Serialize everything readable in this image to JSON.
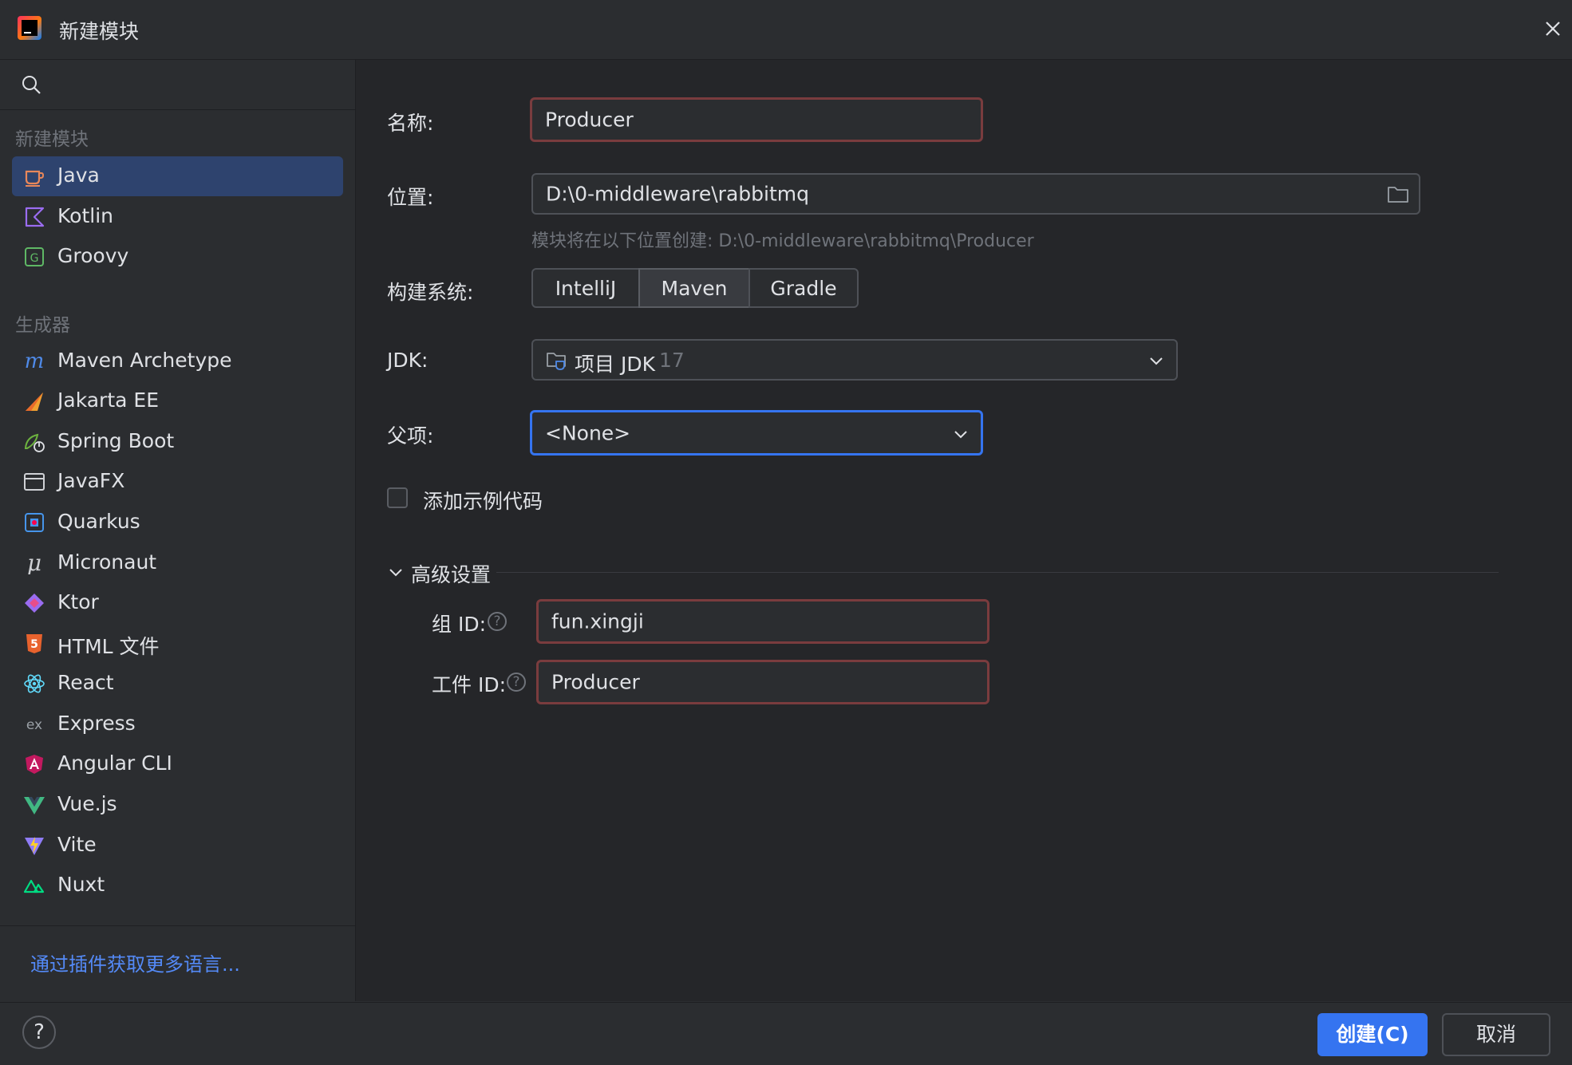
{
  "window": {
    "title": "新建模块"
  },
  "sidebar": {
    "group_new_module": "新建模块",
    "languages": [
      {
        "label": "Java",
        "icon": "java-cup-icon",
        "selected": true
      },
      {
        "label": "Kotlin",
        "icon": "kotlin-icon"
      },
      {
        "label": "Groovy",
        "icon": "groovy-icon"
      }
    ],
    "group_generators": "生成器",
    "generators": [
      {
        "label": "Maven Archetype",
        "icon": "maven-icon"
      },
      {
        "label": "Jakarta EE",
        "icon": "jakarta-ee-icon"
      },
      {
        "label": "Spring Boot",
        "icon": "spring-boot-icon"
      },
      {
        "label": "JavaFX",
        "icon": "javafx-window-icon"
      },
      {
        "label": "Quarkus",
        "icon": "quarkus-icon"
      },
      {
        "label": "Micronaut",
        "icon": "micronaut-icon"
      },
      {
        "label": "Ktor",
        "icon": "ktor-icon"
      },
      {
        "label": "HTML 文件",
        "icon": "html5-icon"
      },
      {
        "label": "React",
        "icon": "react-icon"
      },
      {
        "label": "Express",
        "icon": "express-icon"
      },
      {
        "label": "Angular CLI",
        "icon": "angular-icon"
      },
      {
        "label": "Vue.js",
        "icon": "vue-icon"
      },
      {
        "label": "Vite",
        "icon": "vite-icon"
      },
      {
        "label": "Nuxt",
        "icon": "nuxt-icon"
      }
    ],
    "more_languages_link": "通过插件获取更多语言..."
  },
  "form": {
    "name_label": "名称:",
    "name_value": "Producer",
    "location_label": "位置:",
    "location_value": "D:\\0-middleware\\rabbitmq",
    "location_hint": "模块将在以下位置创建: D:\\0-middleware\\rabbitmq\\Producer",
    "build_label": "构建系统:",
    "build_options": [
      "IntelliJ",
      "Maven",
      "Gradle"
    ],
    "build_selected": "Maven",
    "jdk_label": "JDK:",
    "jdk_value": "项目 JDK",
    "jdk_version": "17",
    "parent_label": "父项:",
    "parent_value": "<None>",
    "sample_code_label": "添加示例代码",
    "sample_code_checked": false,
    "advanced_label": "高级设置",
    "group_id_label": "组 ID:",
    "group_id_value": "fun.xingji",
    "artifact_id_label": "工件 ID:",
    "artifact_id_value": "Producer"
  },
  "footer": {
    "help_label": "?",
    "create_label": "创建(C)",
    "cancel_label": "取消"
  },
  "colors": {
    "accent": "#3574f0",
    "error_border": "#7a3c3e",
    "link": "#548af7",
    "selection": "#2e436e"
  }
}
